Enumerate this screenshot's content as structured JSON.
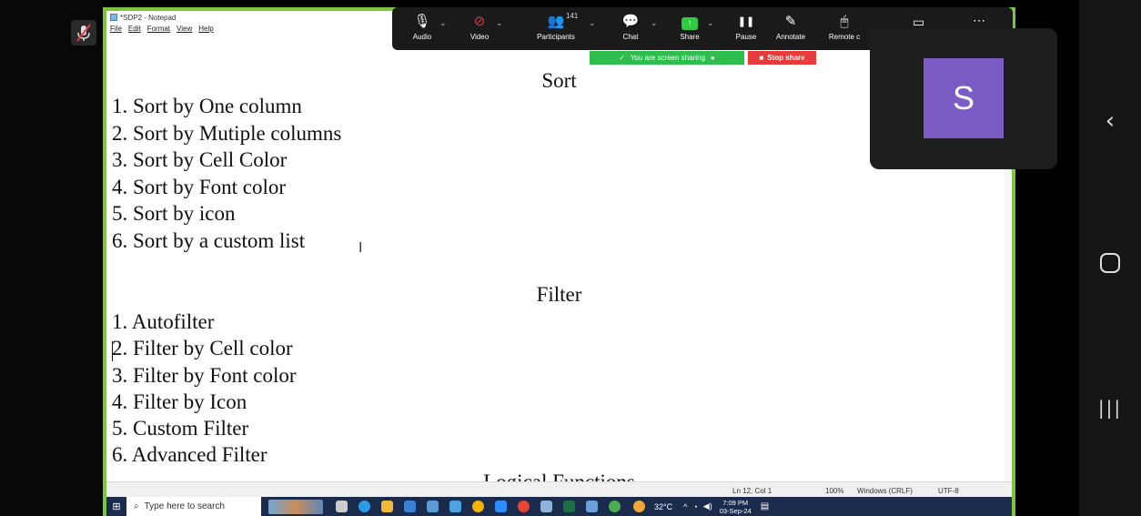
{
  "notepad": {
    "title": "*SDP2 - Notepad",
    "menu": [
      "File",
      "Edit",
      "Format",
      "View",
      "Help"
    ],
    "sections": [
      {
        "heading": "Sort",
        "items": [
          "1. Sort by One column",
          "2. Sort by Mutiple columns",
          "3. Sort by Cell Color",
          "4. Sort by Font color",
          "5. Sort by icon",
          "6. Sort by a custom list"
        ]
      },
      {
        "heading": "Filter",
        "items": [
          "1. Autofilter",
          "2. Filter by Cell color",
          "3. Filter by Font color",
          "4. Filter by Icon",
          "5. Custom Filter",
          "6. Advanced Filter"
        ]
      },
      {
        "heading": "Logical Functions",
        "items": []
      }
    ],
    "cursor_glyph": "I",
    "status": {
      "position": "Ln 12, Col 1",
      "zoom": "100%",
      "line_ending": "Windows (CRLF)",
      "encoding": "UTF-8"
    }
  },
  "zoom_toolbar": {
    "items": [
      {
        "label": "Audio",
        "icon": "microphone-icon",
        "glyph": "🎙"
      },
      {
        "label": "Video",
        "icon": "video-off-icon",
        "glyph": "⊘"
      },
      {
        "label": "Participants",
        "icon": "participants-icon",
        "glyph": "👥"
      },
      {
        "label": "Chat",
        "icon": "chat-icon",
        "glyph": "💬"
      },
      {
        "label": "Share",
        "icon": "share-icon",
        "glyph": "↑"
      },
      {
        "label": "Pause",
        "icon": "pause-icon",
        "glyph": "❚❚"
      },
      {
        "label": "Annotate",
        "icon": "annotate-icon",
        "glyph": "✎"
      },
      {
        "label": "Remote c",
        "icon": "remote-control-icon",
        "glyph": "🖱"
      }
    ],
    "participant_count": "141",
    "sharing_banner": "You are screen sharing",
    "stop_share": "Stop share"
  },
  "participant": {
    "initial": "S",
    "avatar_color": "#7b5cc4"
  },
  "taskbar": {
    "search_placeholder": "Type here to search",
    "temperature": "32°C",
    "time": "7:09 PM",
    "date": "03-Sep-24"
  },
  "colors": {
    "share_border": "#7cc63f",
    "banner_green": "#2dbe4d",
    "stop_red": "#e83b3b",
    "taskbar": "#1b2b4b"
  }
}
